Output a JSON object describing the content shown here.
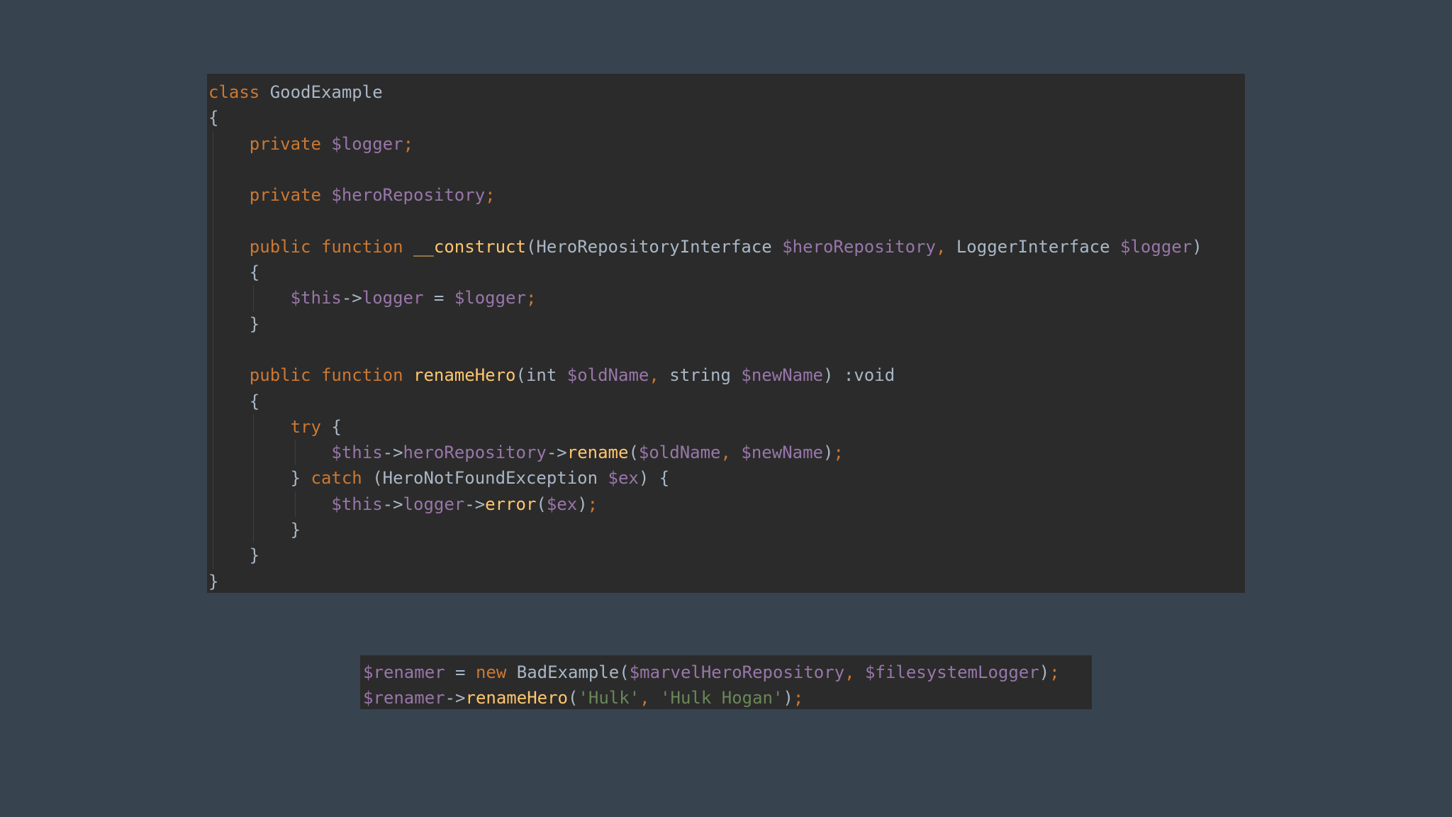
{
  "colors": {
    "background": "#37444f",
    "editor": "#2b2b2b",
    "keyword": "#cc7832",
    "variable": "#9876aa",
    "function": "#ffc66d",
    "string": "#6a8759",
    "text": "#a9b7c6"
  },
  "main_code": {
    "lines": [
      [
        {
          "t": "class",
          "c": "kw"
        },
        {
          "t": " GoodExample",
          "c": "plain"
        }
      ],
      [
        {
          "t": "{",
          "c": "plain"
        }
      ],
      [
        {
          "t": "    ",
          "c": "plain"
        },
        {
          "t": "private",
          "c": "kw"
        },
        {
          "t": " ",
          "c": "plain"
        },
        {
          "t": "$logger",
          "c": "var"
        },
        {
          "t": ";",
          "c": "kw"
        }
      ],
      [],
      [
        {
          "t": "    ",
          "c": "plain"
        },
        {
          "t": "private",
          "c": "kw"
        },
        {
          "t": " ",
          "c": "plain"
        },
        {
          "t": "$heroRepository",
          "c": "var"
        },
        {
          "t": ";",
          "c": "kw"
        }
      ],
      [],
      [
        {
          "t": "    ",
          "c": "plain"
        },
        {
          "t": "public",
          "c": "kw"
        },
        {
          "t": " ",
          "c": "plain"
        },
        {
          "t": "function",
          "c": "kw"
        },
        {
          "t": " ",
          "c": "plain"
        },
        {
          "t": "__construct",
          "c": "fn"
        },
        {
          "t": "(HeroRepositoryInterface ",
          "c": "plain"
        },
        {
          "t": "$heroRepository",
          "c": "var"
        },
        {
          "t": ", ",
          "c": "kw"
        },
        {
          "t": "LoggerInterface ",
          "c": "plain"
        },
        {
          "t": "$logger",
          "c": "var"
        },
        {
          "t": ")",
          "c": "plain"
        }
      ],
      [
        {
          "t": "    {",
          "c": "plain"
        }
      ],
      [
        {
          "t": "        ",
          "c": "plain"
        },
        {
          "t": "$this",
          "c": "var"
        },
        {
          "t": "->",
          "c": "plain"
        },
        {
          "t": "logger",
          "c": "var"
        },
        {
          "t": " = ",
          "c": "plain"
        },
        {
          "t": "$logger",
          "c": "var"
        },
        {
          "t": ";",
          "c": "kw"
        }
      ],
      [
        {
          "t": "    }",
          "c": "plain"
        }
      ],
      [],
      [
        {
          "t": "    ",
          "c": "plain"
        },
        {
          "t": "public",
          "c": "kw"
        },
        {
          "t": " ",
          "c": "plain"
        },
        {
          "t": "function",
          "c": "kw"
        },
        {
          "t": " ",
          "c": "plain"
        },
        {
          "t": "renameHero",
          "c": "fn"
        },
        {
          "t": "(int ",
          "c": "plain"
        },
        {
          "t": "$oldName",
          "c": "var"
        },
        {
          "t": ", ",
          "c": "kw"
        },
        {
          "t": "string ",
          "c": "plain"
        },
        {
          "t": "$newName",
          "c": "var"
        },
        {
          "t": ") :void",
          "c": "plain"
        }
      ],
      [
        {
          "t": "    {",
          "c": "plain"
        }
      ],
      [
        {
          "t": "        ",
          "c": "plain"
        },
        {
          "t": "try",
          "c": "kw"
        },
        {
          "t": " {",
          "c": "plain"
        }
      ],
      [
        {
          "t": "            ",
          "c": "plain"
        },
        {
          "t": "$this",
          "c": "var"
        },
        {
          "t": "->",
          "c": "plain"
        },
        {
          "t": "heroRepository",
          "c": "var"
        },
        {
          "t": "->",
          "c": "plain"
        },
        {
          "t": "rename",
          "c": "fn"
        },
        {
          "t": "(",
          "c": "plain"
        },
        {
          "t": "$oldName",
          "c": "var"
        },
        {
          "t": ", ",
          "c": "kw"
        },
        {
          "t": "$newName",
          "c": "var"
        },
        {
          "t": ")",
          "c": "plain"
        },
        {
          "t": ";",
          "c": "kw"
        }
      ],
      [
        {
          "t": "        } ",
          "c": "plain"
        },
        {
          "t": "catch",
          "c": "kw"
        },
        {
          "t": " (HeroNotFoundException ",
          "c": "plain"
        },
        {
          "t": "$ex",
          "c": "var"
        },
        {
          "t": ") {",
          "c": "plain"
        }
      ],
      [
        {
          "t": "            ",
          "c": "plain"
        },
        {
          "t": "$this",
          "c": "var"
        },
        {
          "t": "->",
          "c": "plain"
        },
        {
          "t": "logger",
          "c": "var"
        },
        {
          "t": "->",
          "c": "plain"
        },
        {
          "t": "error",
          "c": "fn"
        },
        {
          "t": "(",
          "c": "plain"
        },
        {
          "t": "$ex",
          "c": "var"
        },
        {
          "t": ")",
          "c": "plain"
        },
        {
          "t": ";",
          "c": "kw"
        }
      ],
      [
        {
          "t": "        }",
          "c": "plain"
        }
      ],
      [
        {
          "t": "    }",
          "c": "plain"
        }
      ],
      [
        {
          "t": "}",
          "c": "plain"
        }
      ]
    ]
  },
  "usage_code": {
    "lines": [
      [
        {
          "t": "$renamer",
          "c": "var"
        },
        {
          "t": " = ",
          "c": "plain"
        },
        {
          "t": "new",
          "c": "kw"
        },
        {
          "t": " BadExample(",
          "c": "plain"
        },
        {
          "t": "$marvelHeroRepository",
          "c": "var"
        },
        {
          "t": ", ",
          "c": "kw"
        },
        {
          "t": "$filesystemLogger",
          "c": "var"
        },
        {
          "t": ")",
          "c": "plain"
        },
        {
          "t": ";",
          "c": "kw"
        }
      ],
      [
        {
          "t": "$renamer",
          "c": "var"
        },
        {
          "t": "->",
          "c": "plain"
        },
        {
          "t": "renameHero",
          "c": "fn"
        },
        {
          "t": "(",
          "c": "plain"
        },
        {
          "t": "'Hulk'",
          "c": "str"
        },
        {
          "t": ", ",
          "c": "kw"
        },
        {
          "t": "'Hulk Hogan'",
          "c": "str"
        },
        {
          "t": ")",
          "c": "plain"
        },
        {
          "t": ";",
          "c": "kw"
        }
      ]
    ]
  }
}
